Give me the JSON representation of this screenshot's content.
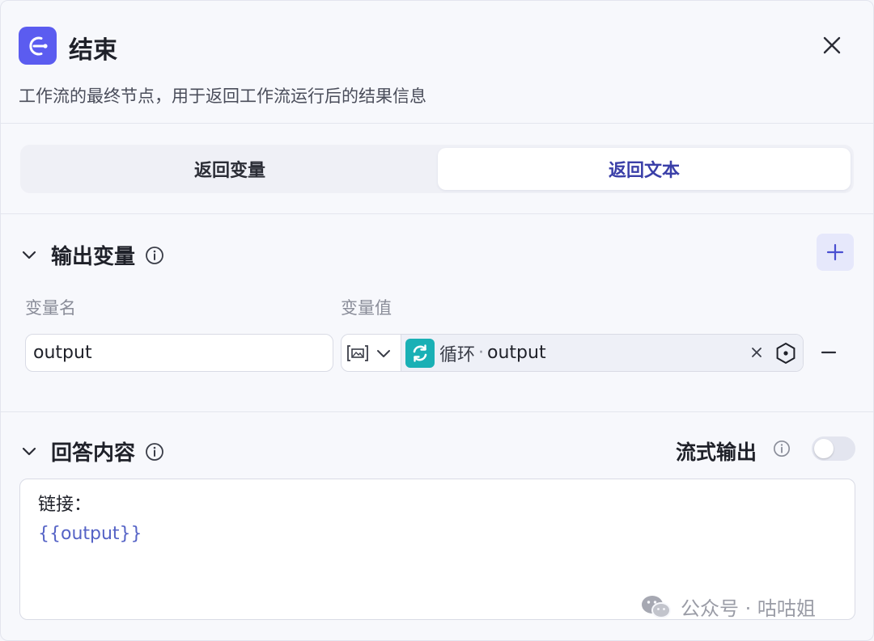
{
  "header": {
    "title": "结束",
    "description": "工作流的最终节点，用于返回工作流运行后的结果信息",
    "node_icon": "exit-icon",
    "close_icon": "close-icon"
  },
  "tabs": [
    {
      "label": "返回变量",
      "active": false
    },
    {
      "label": "返回文本",
      "active": true
    }
  ],
  "output_section": {
    "title": "输出变量",
    "columns": {
      "name": "变量名",
      "value": "变量值"
    },
    "rows": [
      {
        "name": "output",
        "source_node": "循环",
        "separator": "·",
        "variable": "output"
      }
    ]
  },
  "answer_section": {
    "title": "回答内容",
    "stream_label": "流式输出",
    "stream_enabled": false,
    "content_line1": "链接：",
    "content_line2": "{{output}}"
  },
  "watermark": {
    "text": "公众号 · 咕咕姐"
  },
  "colors": {
    "accent": "#5b5cf0",
    "active_tab_text": "#3a3fa8",
    "loop_node": "#1ab0b5",
    "variable_ref": "#5563c6"
  }
}
